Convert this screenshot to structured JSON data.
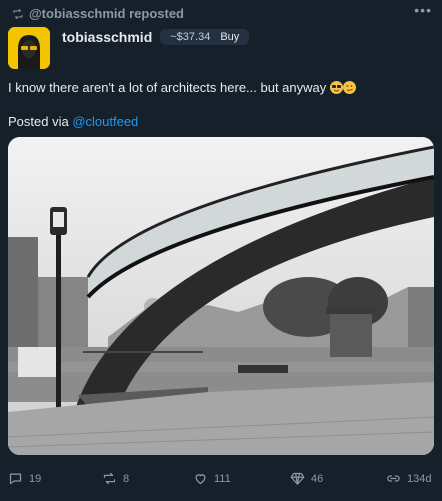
{
  "header": {
    "repost_text": "@tobiasschmid reposted",
    "more_label": "•••"
  },
  "author": {
    "name": "tobiasschmid",
    "price": "~$37.34",
    "buy_label": "Buy"
  },
  "tweet": {
    "text": "I know there aren't a lot of architects here... but anyway",
    "posted_via_prefix": "Posted via",
    "posted_via_handle": "@cloutfeed"
  },
  "actions": {
    "replies": "19",
    "reposts": "8",
    "likes": "111",
    "tips": "46",
    "views": "134d"
  },
  "colors": {
    "background": "#15202b",
    "link": "#1d9bf0",
    "muted": "#8b98a5",
    "avatar": "#f3c500"
  },
  "icons": [
    "repost-icon",
    "more-icon",
    "reply-icon",
    "retweet-icon",
    "heart-icon",
    "diamond-icon",
    "link-icon"
  ]
}
